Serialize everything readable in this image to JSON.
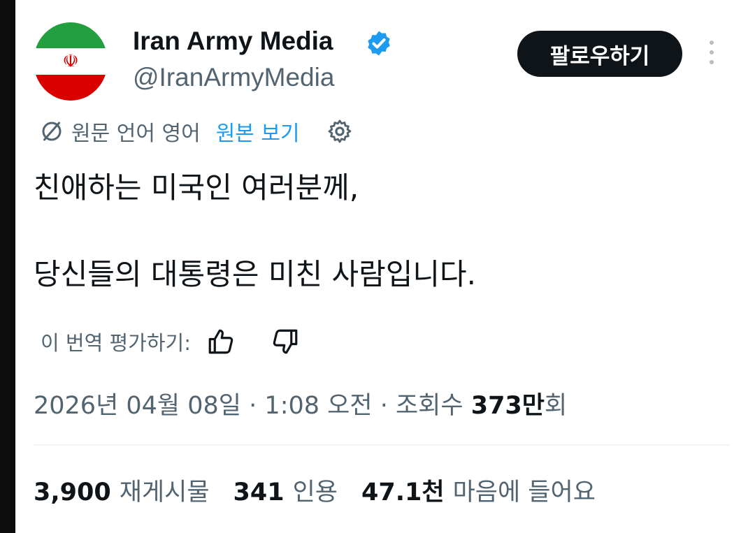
{
  "account": {
    "display_name": "Iran Army Media",
    "handle": "@IranArmyMedia",
    "avatar_icon": "iran-flag-icon",
    "avatar_emblem": "☫",
    "verified_color": "#1d9bf0"
  },
  "actions": {
    "follow_label": "팔로우하기"
  },
  "translation": {
    "source_language_text": "원문 언어 영어",
    "view_original_label": "원본 보기"
  },
  "tweet": {
    "line1": "친애하는 미국인 여러분께,",
    "line2": "당신들의 대통령은 미친 사람입니다."
  },
  "rating": {
    "label": "이 번역 평가하기:"
  },
  "meta": {
    "date": "2026년 04월 08일",
    "time": "1:08 오전",
    "separator": "·",
    "views_label": "조회수",
    "views_value": "373만",
    "views_suffix": "회"
  },
  "stats": {
    "retweets_value": "3,900",
    "retweets_label": "재게시물",
    "quotes_value": "341",
    "quotes_label": "인용",
    "likes_value": "47.1천",
    "likes_label": "마음에 들어요"
  },
  "colors": {
    "text": "#0f1419",
    "secondary": "#536471",
    "accent": "#1d9bf0",
    "button_bg": "#0f1419"
  }
}
